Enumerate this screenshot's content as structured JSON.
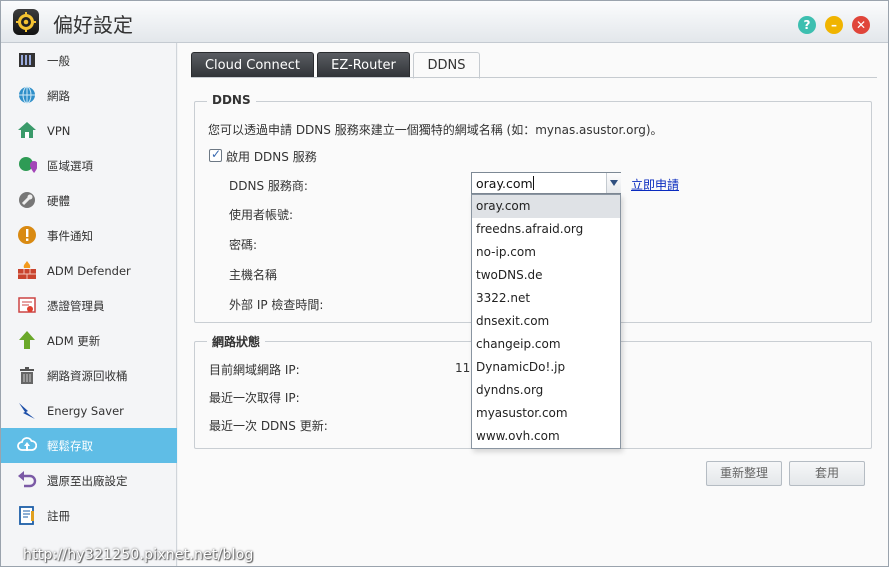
{
  "window": {
    "title": "偏好設定",
    "help_glyph": "?",
    "minimize_glyph": "–",
    "close_glyph": "✕"
  },
  "sidebar": {
    "items": [
      {
        "label": "一般",
        "icon": "server-icon"
      },
      {
        "label": "網路",
        "icon": "globe-icon"
      },
      {
        "label": "VPN",
        "icon": "vpn-house-icon"
      },
      {
        "label": "區域選項",
        "icon": "region-map-pin-icon"
      },
      {
        "label": "硬體",
        "icon": "hardware-wrench-icon"
      },
      {
        "label": "事件通知",
        "icon": "alert-icon"
      },
      {
        "label": "ADM Defender",
        "icon": "firewall-icon"
      },
      {
        "label": "憑證管理員",
        "icon": "certificate-icon"
      },
      {
        "label": "ADM 更新",
        "icon": "update-arrow-icon"
      },
      {
        "label": "網路資源回收桶",
        "icon": "trash-icon"
      },
      {
        "label": "Energy Saver",
        "icon": "energy-bolt-icon"
      },
      {
        "label": "輕鬆存取",
        "icon": "cloud-upload-icon",
        "active": true
      },
      {
        "label": "還原至出廠設定",
        "icon": "restore-arrow-icon"
      },
      {
        "label": "註冊",
        "icon": "register-icon"
      }
    ]
  },
  "tabs": [
    {
      "label": "Cloud Connect"
    },
    {
      "label": "EZ-Router"
    },
    {
      "label": "DDNS",
      "active": true
    }
  ],
  "ddns": {
    "group_title": "DDNS",
    "description": "您可以透過申請 DDNS 服務來建立一個獨特的網域名稱 (如：mynas.asustor.org)。",
    "enable_label": "啟用 DDNS 服務",
    "enable_checked": true,
    "provider_label": "DDNS 服務商:",
    "provider_value": "oray.com",
    "apply_link": "立即申請",
    "username_label": "使用者帳號:",
    "password_label": "密碼:",
    "hostname_label": "主機名稱",
    "external_ip_label": "外部 IP 檢查時間:",
    "provider_options": [
      "oray.com",
      "freedns.afraid.org",
      "no-ip.com",
      "twoDNS.de",
      "3322.net",
      "dnsexit.com",
      "changeip.com",
      "DynamicDo!.jp",
      "dyndns.org",
      "myasustor.com",
      "www.ovh.com"
    ]
  },
  "network_status": {
    "group_title": "網路狀態",
    "current_ip_label": "目前網域網路 IP:",
    "current_ip_value": "11",
    "last_ip_label": "最近一次取得 IP:",
    "last_update_label": "最近一次 DDNS 更新:"
  },
  "buttons": {
    "refresh": "重新整理",
    "apply": "套用"
  },
  "watermark": "http://hy321250.pixnet.net/blog"
}
